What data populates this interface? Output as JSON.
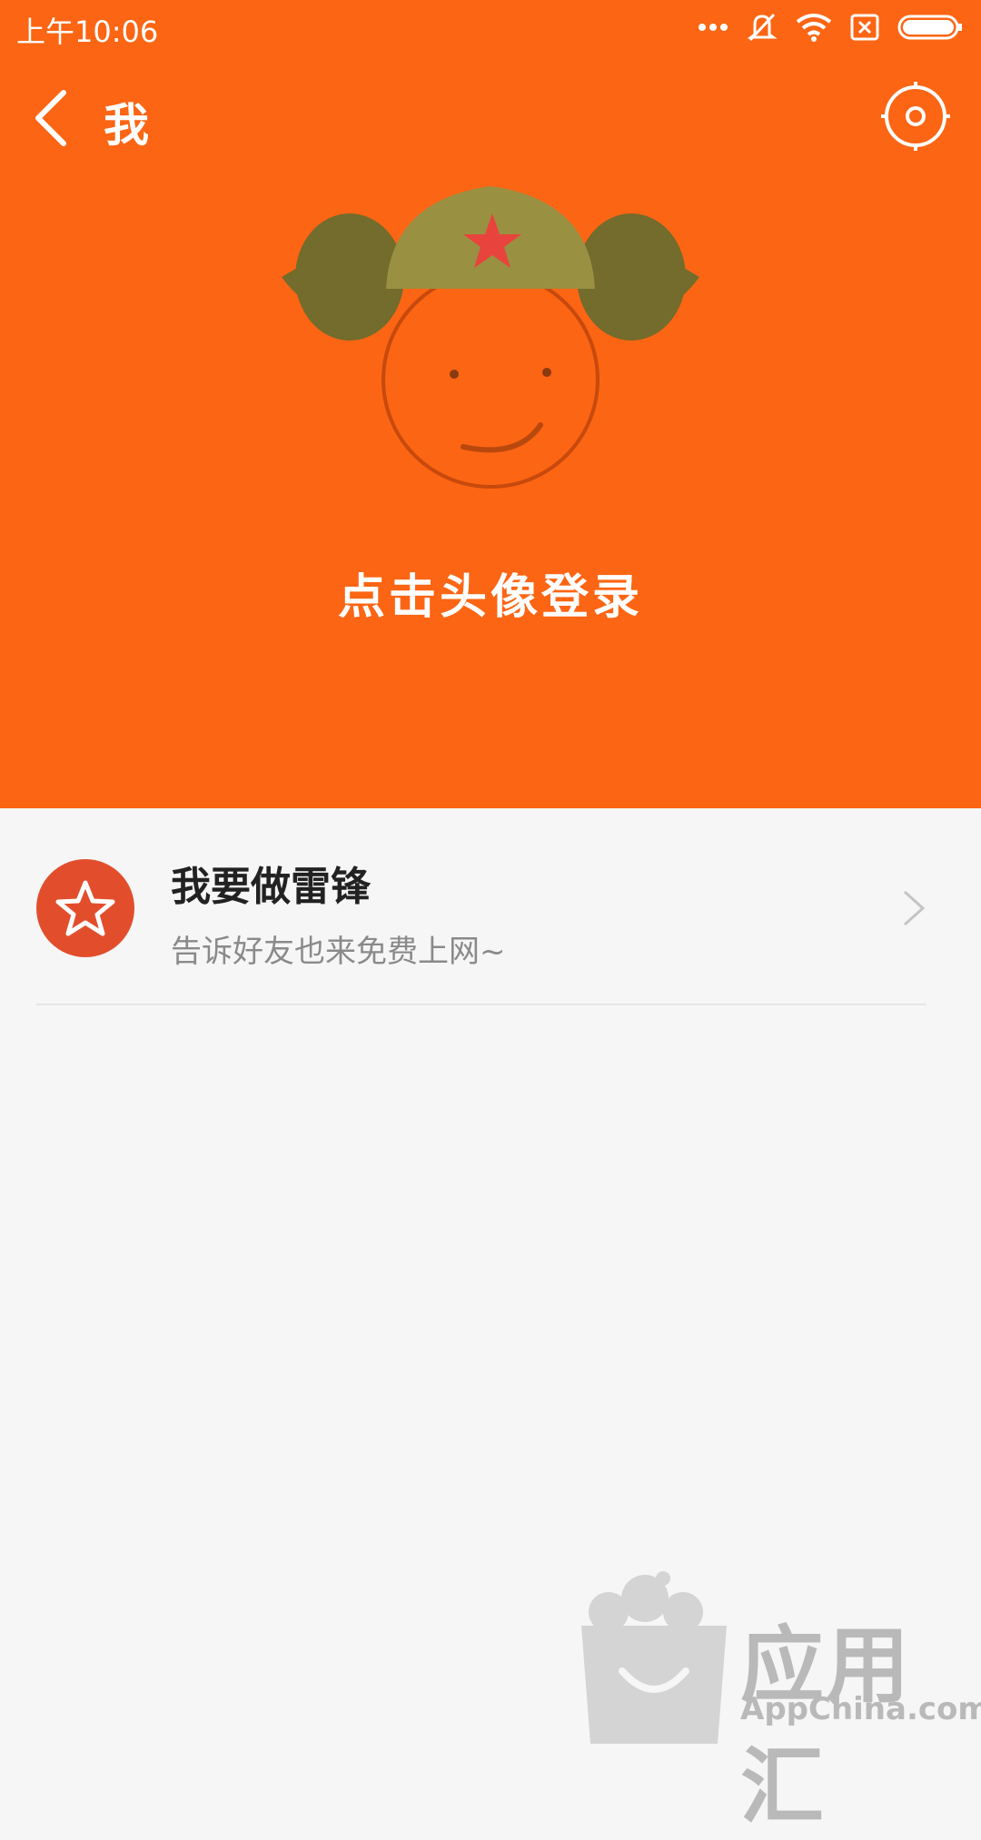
{
  "status_bar": {
    "time": "上午10:06",
    "icons": [
      "more-dots-icon",
      "mute-icon",
      "wifi-icon",
      "sim-none-icon",
      "battery-icon"
    ]
  },
  "nav": {
    "back_icon": "chevron-left-icon",
    "title": "我",
    "settings_icon": "settings-icon"
  },
  "header": {
    "login_prompt": "点击头像登录",
    "accent_color": "#fc6513"
  },
  "list": {
    "items": [
      {
        "title": "我要做雷锋",
        "subtitle": "告诉好友也来免费上网~",
        "icon": "star-icon"
      }
    ]
  },
  "watermark": {
    "cn": "应用汇",
    "en": "AppChina.com"
  }
}
